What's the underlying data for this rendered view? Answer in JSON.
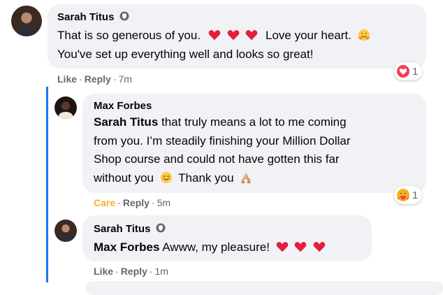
{
  "comments": [
    {
      "author": "Sarah Titus",
      "author_badge": "shield-badge-icon",
      "lines": [
        "That is so generous of you.",
        "Love your heart.",
        "You've set up everything well and looks so great!"
      ],
      "actions": {
        "like": "Like",
        "reply": "Reply",
        "time": "7m"
      },
      "reaction_count": "1",
      "reaction_icon": "love-reaction-icon"
    },
    {
      "author": "Max Forbes",
      "mention": "Sarah Titus",
      "lines": [
        " that truly means a lot to me coming",
        "from you. I’m steadily finishing your Million Dollar",
        "Shop course and could not have gotten this far",
        "without you",
        "Thank you"
      ],
      "actions": {
        "like": "Care",
        "reply": "Reply",
        "time": "5m"
      },
      "reaction_count": "1",
      "reaction_icon": "care-reaction-icon"
    },
    {
      "author": "Sarah Titus",
      "author_badge": "shield-badge-icon",
      "mention": "Max Forbes",
      "lines": [
        " Awww, my pleasure!"
      ],
      "actions": {
        "like": "Like",
        "reply": "Reply",
        "time": "1m"
      }
    }
  ],
  "colors": {
    "bubble": "#f0f2f5",
    "thread_line": "#1877f2",
    "heart": "#e41e3f",
    "care": "#f7b125",
    "meta_text": "#65676b"
  }
}
